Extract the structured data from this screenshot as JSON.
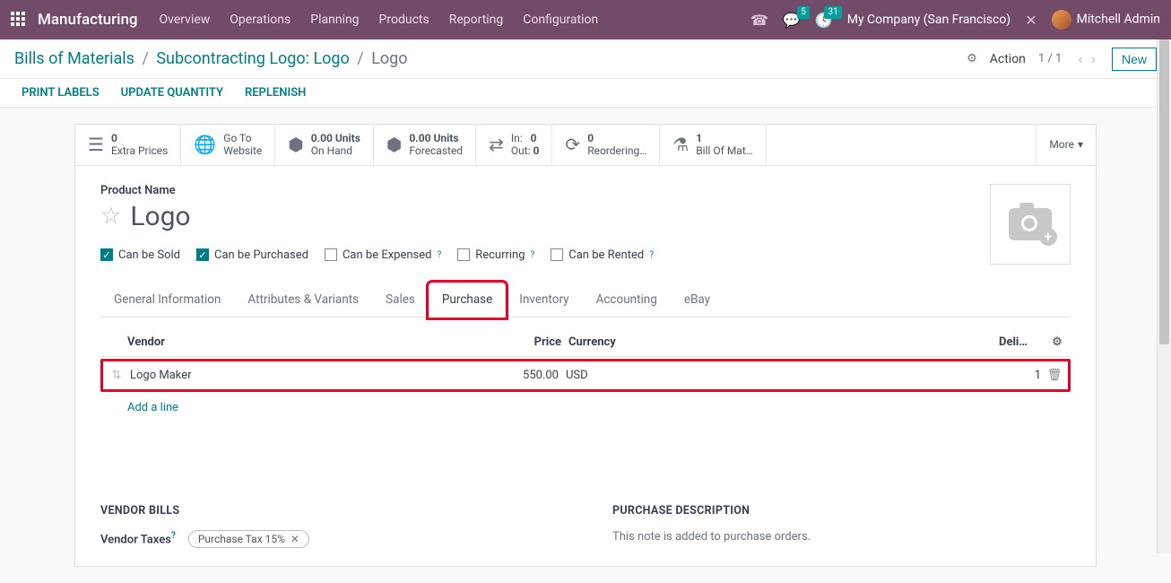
{
  "nav": {
    "brand": "Manufacturing",
    "items": [
      "Overview",
      "Operations",
      "Planning",
      "Products",
      "Reporting",
      "Configuration"
    ],
    "messages_badge": "5",
    "activities_badge": "31",
    "company": "My Company (San Francisco)",
    "user": "Mitchell Admin"
  },
  "breadcrumb": {
    "a": "Bills of Materials",
    "b": "Subcontracting Logo: Logo",
    "c": "Logo"
  },
  "cp": {
    "action": "Action",
    "pager": "1 / 1",
    "new": "New"
  },
  "actions": [
    "PRINT LABELS",
    "UPDATE QUANTITY",
    "REPLENISH"
  ],
  "stats": {
    "extra_prices": {
      "v": "0",
      "l": "Extra Prices"
    },
    "goto": {
      "v": "Go To",
      "l": "Website"
    },
    "onhand": {
      "v": "0.00 Units",
      "l": "On Hand"
    },
    "forecast": {
      "v": "0.00 Units",
      "l": "Forecasted"
    },
    "inout": {
      "in_l": "In:",
      "in_v": "0",
      "out_l": "Out:",
      "out_v": "0"
    },
    "reorder": {
      "v": "0",
      "l": "Reordering…"
    },
    "bom": {
      "v": "1",
      "l": "Bill Of Mat…"
    },
    "more": "More"
  },
  "form": {
    "name_label": "Product Name",
    "name": "Logo",
    "checks": {
      "sold": "Can be Sold",
      "purchased": "Can be Purchased",
      "expensed": "Can be Expensed",
      "recurring": "Recurring",
      "rented": "Can be Rented"
    },
    "tabs": [
      "General Information",
      "Attributes & Variants",
      "Sales",
      "Purchase",
      "Inventory",
      "Accounting",
      "eBay"
    ],
    "table": {
      "h_vendor": "Vendor",
      "h_price": "Price",
      "h_currency": "Currency",
      "h_deli": "Deli…",
      "row": {
        "vendor": "Logo Maker",
        "price": "550.00",
        "currency": "USD",
        "qty": "1"
      },
      "add": "Add a line"
    },
    "vendor_bills": {
      "title": "VENDOR BILLS",
      "taxes_label": "Vendor Taxes",
      "tax_tag": "Purchase Tax 15%"
    },
    "purchase_desc": {
      "title": "PURCHASE DESCRIPTION",
      "note": "This note is added to purchase orders."
    }
  }
}
